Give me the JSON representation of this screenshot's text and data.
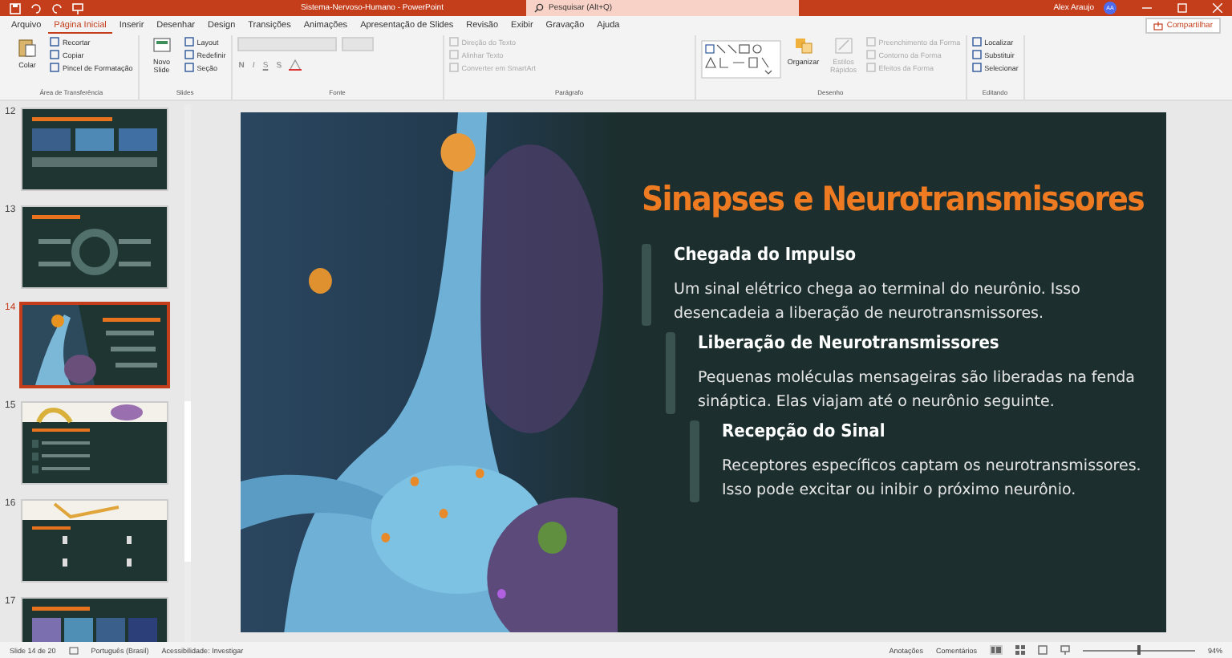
{
  "window": {
    "title": "Sistema-Nervoso-Humano - PowerPoint",
    "search_placeholder": "Pesquisar (Alt+Q)",
    "user": "Alex Araujo",
    "avatar": "AA"
  },
  "tabs": [
    {
      "label": "Arquivo",
      "selected": false
    },
    {
      "label": "Página Inicial",
      "selected": true
    },
    {
      "label": "Inserir",
      "selected": false
    },
    {
      "label": "Desenhar",
      "selected": false
    },
    {
      "label": "Design",
      "selected": false
    },
    {
      "label": "Transições",
      "selected": false
    },
    {
      "label": "Animações",
      "selected": false
    },
    {
      "label": "Apresentação de Slides",
      "selected": false
    },
    {
      "label": "Revisão",
      "selected": false
    },
    {
      "label": "Exibir",
      "selected": false
    },
    {
      "label": "Gravação",
      "selected": false
    },
    {
      "label": "Ajuda",
      "selected": false
    }
  ],
  "share_button": "Compartilhar",
  "ribbon": [
    {
      "label": "Área de Transferência",
      "big": {
        "label": "Colar",
        "disabled": false
      },
      "items": [
        {
          "label": "Recortar",
          "disabled": false
        },
        {
          "label": "Copiar",
          "disabled": false
        },
        {
          "label": "Pincel de Formatação",
          "disabled": false
        }
      ]
    },
    {
      "label": "Slides",
      "big": {
        "label": "Novo Slide",
        "disabled": false
      },
      "items": [
        {
          "label": "Layout",
          "disabled": false
        },
        {
          "label": "Redefinir",
          "disabled": false
        },
        {
          "label": "Seção",
          "disabled": false
        }
      ]
    },
    {
      "label": "Fonte",
      "format_buttons": [
        "N",
        "I",
        "S",
        "S"
      ]
    },
    {
      "label": "Parágrafo",
      "items": [
        {
          "label": "Direção do Texto",
          "disabled": true
        },
        {
          "label": "Alinhar Texto",
          "disabled": true
        },
        {
          "label": "Converter em SmartArt",
          "disabled": true
        }
      ]
    },
    {
      "label": "Desenho",
      "big": {
        "label": "Organizar",
        "disabled": false
      },
      "big2": {
        "label": "Estilos Rápidos",
        "disabled": true
      },
      "items": [
        {
          "label": "Preenchimento da Forma",
          "disabled": true
        },
        {
          "label": "Contorno da Forma",
          "disabled": true
        },
        {
          "label": "Efeitos da Forma",
          "disabled": true
        }
      ]
    },
    {
      "label": "Editando",
      "items": [
        {
          "label": "Localizar",
          "disabled": false
        },
        {
          "label": "Substituir",
          "disabled": false
        },
        {
          "label": "Selecionar",
          "disabled": false
        }
      ]
    }
  ],
  "thumbnails": [
    {
      "number": "12",
      "selected": false
    },
    {
      "number": "13",
      "selected": false
    },
    {
      "number": "14",
      "selected": true
    },
    {
      "number": "15",
      "selected": false
    },
    {
      "number": "16",
      "selected": false
    },
    {
      "number": "17",
      "selected": false
    }
  ],
  "slide": {
    "title": "Sinapses e Neurotransmissores",
    "sections": [
      {
        "heading": "Chegada do Impulso",
        "body": "Um sinal elétrico chega ao terminal do neurônio. Isso desencadeia a liberação de neurotransmissores."
      },
      {
        "heading": "Liberação de Neurotransmissores",
        "body": "Pequenas moléculas mensageiras são liberadas na fenda sináptica. Elas viajam até o neurônio seguinte."
      },
      {
        "heading": "Recepção do Sinal",
        "body": "Receptores específicos captam os neurotransmissores. Isso pode excitar ou inibir o próximo neurônio."
      }
    ]
  },
  "status_bar": {
    "slide": "Slide 14 de 20",
    "language": "Português (Brasil)",
    "accessibility": "Acessibilidade: Investigar",
    "notes": "Anotações",
    "comments": "Comentários",
    "zoom": "94%",
    "zoom_slider": {
      "level": 0.5
    }
  }
}
